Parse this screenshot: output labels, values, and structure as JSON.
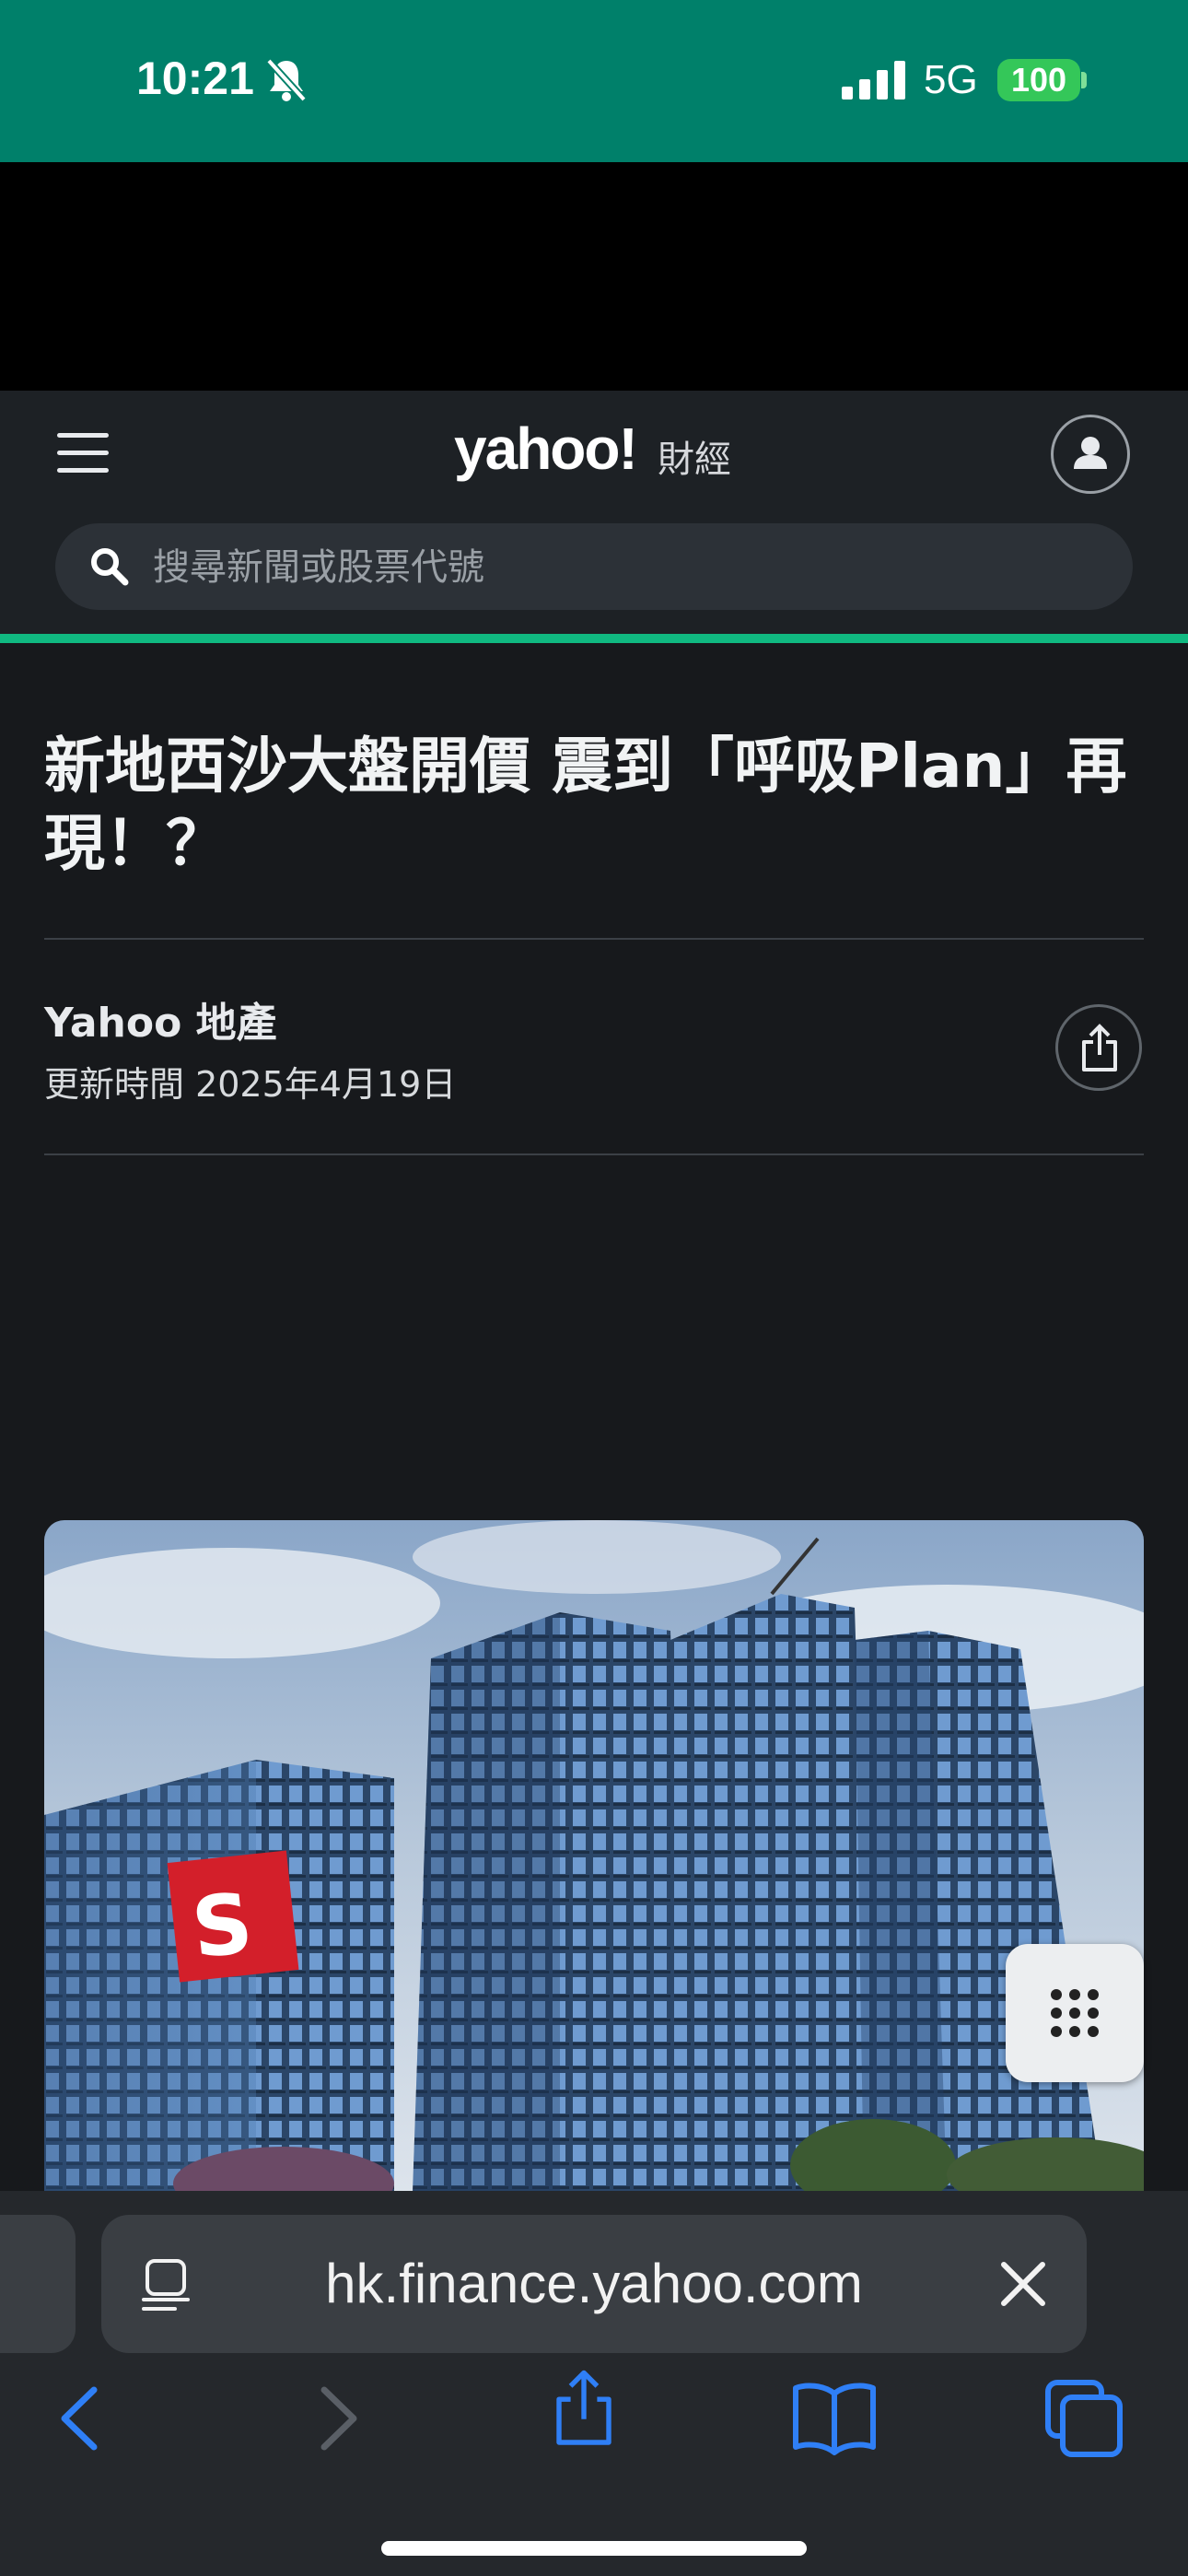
{
  "status_bar": {
    "time": "10:21",
    "network": "5G",
    "battery": "100",
    "background": "#00806a",
    "icons": [
      "bell-slash-icon",
      "signal-icon",
      "battery-icon"
    ]
  },
  "header": {
    "logo": "yahoo!",
    "logo_sub": "財經",
    "menu_icon": "hamburger-icon",
    "profile_icon": "user-icon",
    "search_placeholder": "搜尋新聞或股票代號",
    "accent": "#10b981"
  },
  "article": {
    "headline": "新地西沙大盤開價 震到「呼吸Plan」再現！？",
    "author": "Yahoo 地產",
    "updated": "更新時間 2025年4月19日",
    "share_icon": "share-icon",
    "image_description_icon": "apartment-towers-photo"
  },
  "floating": {
    "grid_icon": "grid-dots-icon"
  },
  "browser": {
    "url": "hk.finance.yahoo.com",
    "reader_icon": "reader-icon",
    "close_icon": "close-icon",
    "toolbar": [
      "back-icon",
      "forward-icon",
      "share-icon",
      "bookmarks-icon",
      "tabs-icon"
    ],
    "accent": "#2f7ff6"
  }
}
